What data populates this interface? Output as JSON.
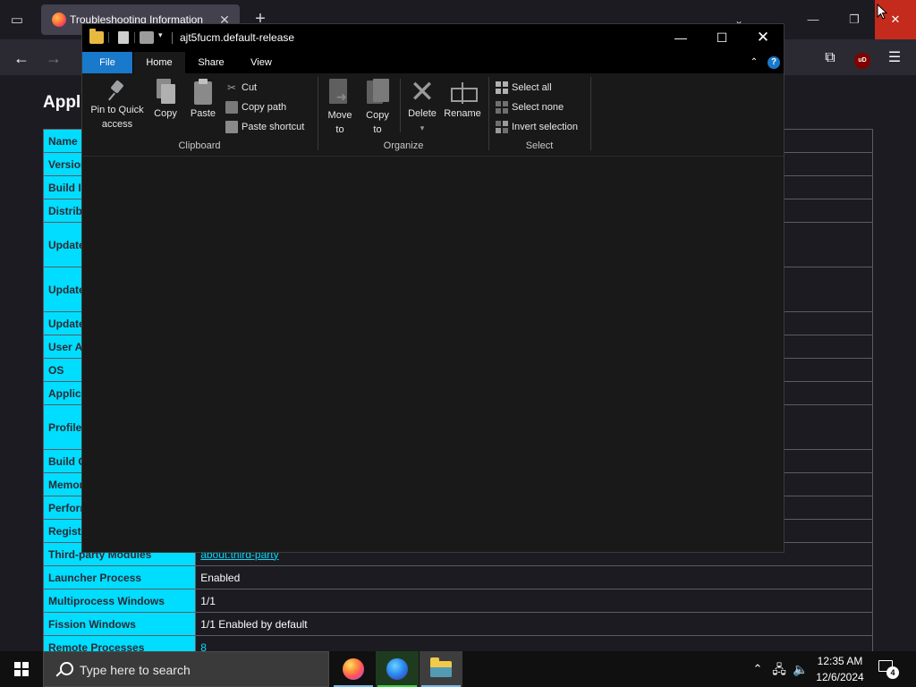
{
  "firefox": {
    "tab_title": "Troubleshooting Information",
    "page_heading": "Applic",
    "table_rows": [
      {
        "key": "Name",
        "value": ""
      },
      {
        "key": "Version",
        "value": ""
      },
      {
        "key": "Build ID",
        "value": ""
      },
      {
        "key": "Distribution ID",
        "value": ""
      },
      {
        "key": "Update Folder",
        "value": "",
        "tall": true
      },
      {
        "key": "Update Directory",
        "value": "",
        "tall": true
      },
      {
        "key": "Update History",
        "value": ""
      },
      {
        "key": "User Agent",
        "value": ""
      },
      {
        "key": "OS",
        "value": ""
      },
      {
        "key": "Application Binary",
        "value": ""
      },
      {
        "key": "Profile Folder",
        "value": "",
        "tall": true
      },
      {
        "key": "Build Config",
        "value": ""
      },
      {
        "key": "Memory Use",
        "value": ""
      },
      {
        "key": "Performance",
        "value": ""
      },
      {
        "key": "Registered Service Workers",
        "value": ""
      },
      {
        "key": "Third-party Modules",
        "value": "about:third-party",
        "link": true
      },
      {
        "key": "Launcher Process",
        "value": "Enabled"
      },
      {
        "key": "Multiprocess Windows",
        "value": "1/1"
      },
      {
        "key": "Fission Windows",
        "value": "1/1 Enabled by default"
      },
      {
        "key": "Remote Processes",
        "value": "8",
        "link": true
      }
    ],
    "accent_color": "#00ddff"
  },
  "explorer": {
    "title": "ajt5fucm.default-release",
    "tabs": {
      "file": "File",
      "home": "Home",
      "share": "Share",
      "view": "View"
    },
    "help_label": "?",
    "ribbon": {
      "clipboard": {
        "group_label": "Clipboard",
        "pin_label_1": "Pin to Quick",
        "pin_label_2": "access",
        "copy_label": "Copy",
        "paste_label": "Paste",
        "cut_label": "Cut",
        "copy_path_label": "Copy path",
        "paste_shortcut_label": "Paste shortcut"
      },
      "organize": {
        "group_label": "Organize",
        "move_label_1": "Move",
        "move_label_2": "to",
        "copy_to_label_1": "Copy",
        "copy_to_label_2": "to",
        "delete_label": "Delete",
        "rename_label": "Rename"
      },
      "select": {
        "group_label": "Select",
        "select_all_label": "Select all",
        "select_none_label": "Select none",
        "invert_label": "Invert selection"
      }
    },
    "accent_color": "#1979ca"
  },
  "taskbar": {
    "search_placeholder": "Type here to search",
    "time": "12:35 AM",
    "date": "12/6/2024",
    "notification_count": "4",
    "apps": [
      "firefox",
      "firefox-developer-edition",
      "file-explorer"
    ]
  },
  "icons": {
    "ublock": "uD"
  }
}
